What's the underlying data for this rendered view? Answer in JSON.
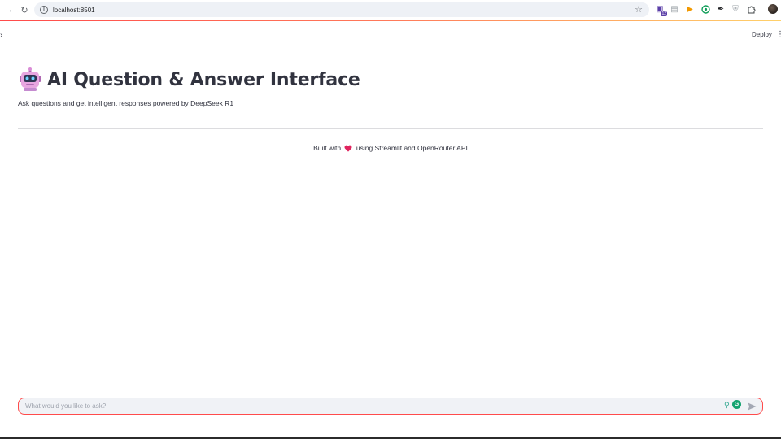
{
  "browser": {
    "url": "localhost:8501",
    "extension_badge": "12"
  },
  "header": {
    "deploy_label": "Deploy"
  },
  "main": {
    "title": "AI Question & Answer Interface",
    "subtitle": "Ask questions and get intelligent responses powered by DeepSeek R1",
    "footer_prefix": "Built with",
    "footer_suffix": "using Streamlit and OpenRouter API"
  },
  "chat": {
    "placeholder": "What would you like to ask?",
    "value": ""
  },
  "colors": {
    "accent": "#ff4b4b",
    "text": "#31333f",
    "input_bg": "#f0f2f6",
    "heart": "#e0245e"
  },
  "icons": {
    "title_emoji": "robot-icon",
    "footer_emoji": "heart-icon"
  }
}
